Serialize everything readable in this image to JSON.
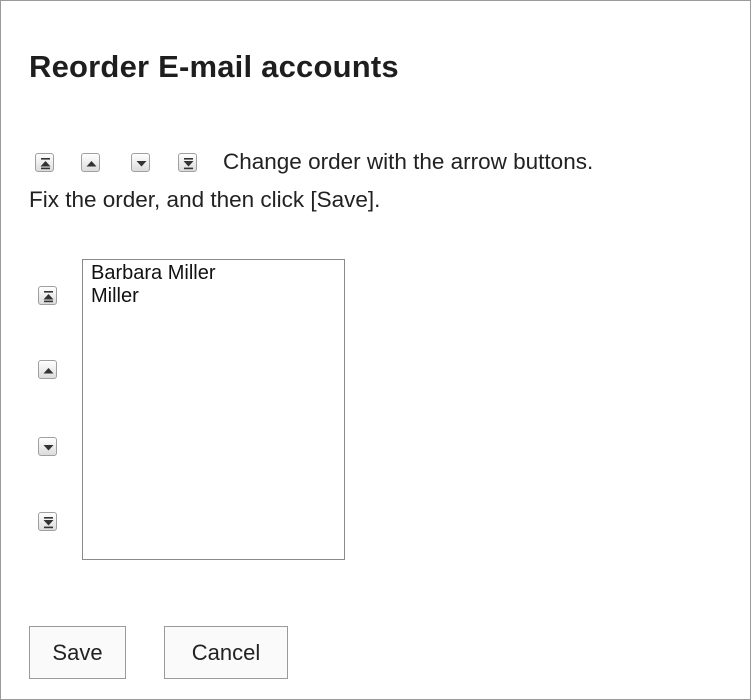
{
  "page": {
    "title": "Reorder E-mail accounts",
    "instruction_line1": "Change order with the arrow buttons.",
    "instruction_line2": "Fix the order, and then click [Save]."
  },
  "icons": {
    "move_top": "move-to-top-icon",
    "move_up": "move-up-icon",
    "move_down": "move-down-icon",
    "move_bottom": "move-to-bottom-icon"
  },
  "account_list": {
    "items": [
      "Barbara Miller",
      "Miller"
    ]
  },
  "buttons": {
    "save": "Save",
    "cancel": "Cancel"
  }
}
